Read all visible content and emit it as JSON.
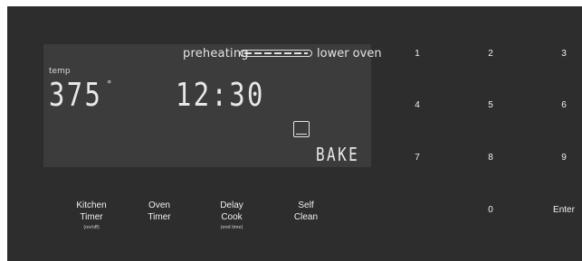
{
  "display": {
    "preheating_label": "preheating",
    "oven_label": "lower oven",
    "temp_label": "temp",
    "temperature": "375",
    "degree_symbol": "°",
    "clock": "12:30",
    "mode": "BAKE",
    "colors": {
      "panel": "#2d2d2d",
      "lcd": "#3c3c3c",
      "segment": "#e8e8e8"
    }
  },
  "keypad": {
    "k1": "1",
    "k2": "2",
    "k3": "3",
    "k4": "4",
    "k5": "5",
    "k6": "6",
    "k7": "7",
    "k8": "8",
    "k9": "9",
    "k0": "0",
    "enter": "Enter"
  },
  "functions": {
    "kitchen_timer": {
      "line1": "Kitchen",
      "line2": "Timer",
      "sub": "(on/off)"
    },
    "oven_timer": {
      "line1": "Oven",
      "line2": "Timer"
    },
    "delay_cook": {
      "line1": "Delay",
      "line2": "Cook",
      "sub": "(end time)"
    },
    "self_clean": {
      "line1": "Self",
      "line2": "Clean"
    }
  },
  "icons": {
    "oven_indicator": "oven-window-icon",
    "preheat_progress": "preheat-progress-bar"
  }
}
